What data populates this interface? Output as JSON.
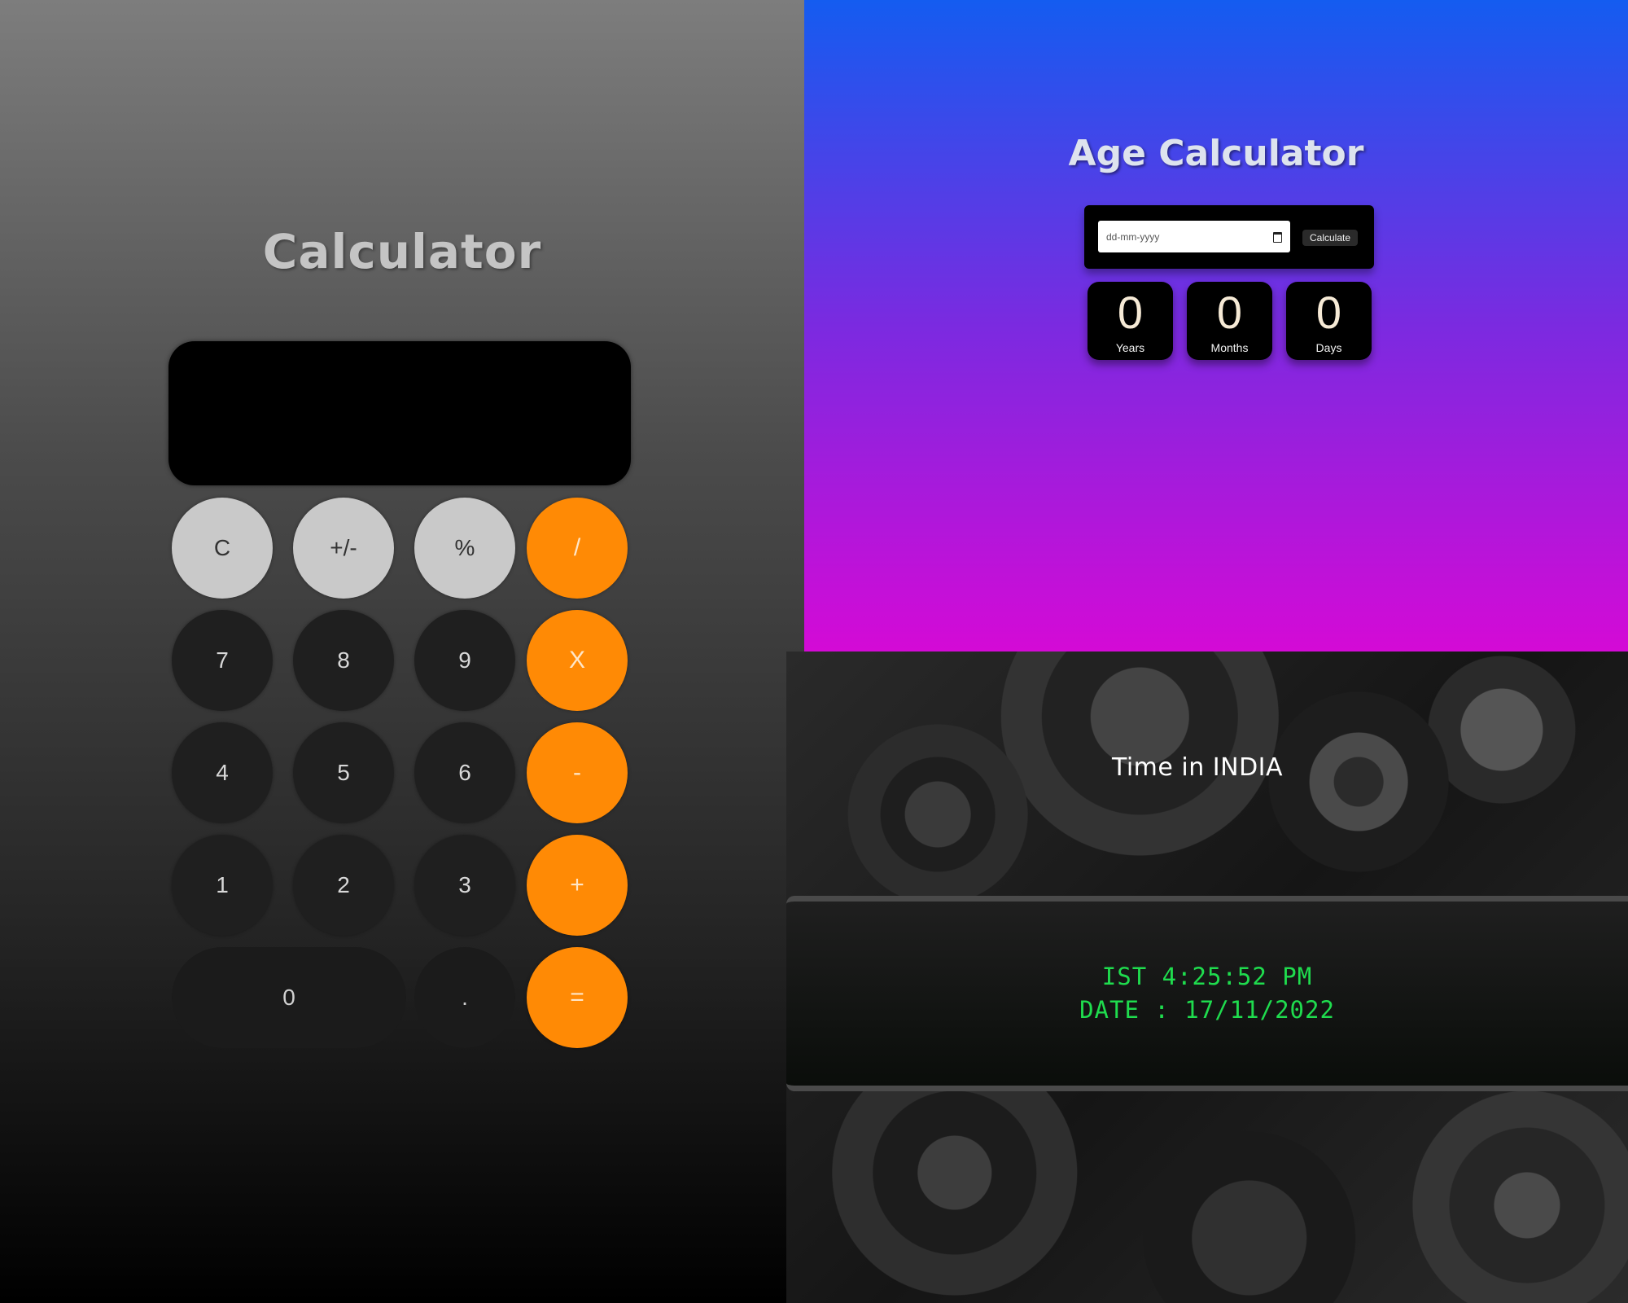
{
  "calculator": {
    "title": "Calculator",
    "display_value": "",
    "buttons": [
      {
        "key": "clear",
        "label": "C"
      },
      {
        "key": "plusminus",
        "label": "+/-"
      },
      {
        "key": "percent",
        "label": "%"
      },
      {
        "key": "divide",
        "label": "/"
      },
      {
        "key": "seven",
        "label": "7"
      },
      {
        "key": "eight",
        "label": "8"
      },
      {
        "key": "nine",
        "label": "9"
      },
      {
        "key": "multiply",
        "label": "X"
      },
      {
        "key": "four",
        "label": "4"
      },
      {
        "key": "five",
        "label": "5"
      },
      {
        "key": "six",
        "label": "6"
      },
      {
        "key": "minus",
        "label": "-"
      },
      {
        "key": "one",
        "label": "1"
      },
      {
        "key": "two",
        "label": "2"
      },
      {
        "key": "three",
        "label": "3"
      },
      {
        "key": "plus",
        "label": "+"
      },
      {
        "key": "zero",
        "label": "0"
      },
      {
        "key": "decimal",
        "label": "."
      },
      {
        "key": "equals",
        "label": "="
      }
    ],
    "colors": {
      "operator": "#ff8a05",
      "function": "#c9c9c9",
      "digit": "#1f1f1f"
    }
  },
  "age_calculator": {
    "title": "Age Calculator",
    "date_input_placeholder": "dd-mm-yyyy",
    "calculate_label": "Calculate",
    "results": [
      {
        "value": "0",
        "label": "Years"
      },
      {
        "value": "0",
        "label": "Months"
      },
      {
        "value": "0",
        "label": "Days"
      }
    ],
    "colors": {
      "gradient_top": "#145cf0",
      "gradient_bottom": "#d40ad6"
    }
  },
  "world_clock": {
    "title": "Time in INDIA",
    "time_text": "IST 4:25:52 PM",
    "date_text": "DATE : 17/11/2022",
    "colors": {
      "digits": "#1fdc4e"
    }
  }
}
